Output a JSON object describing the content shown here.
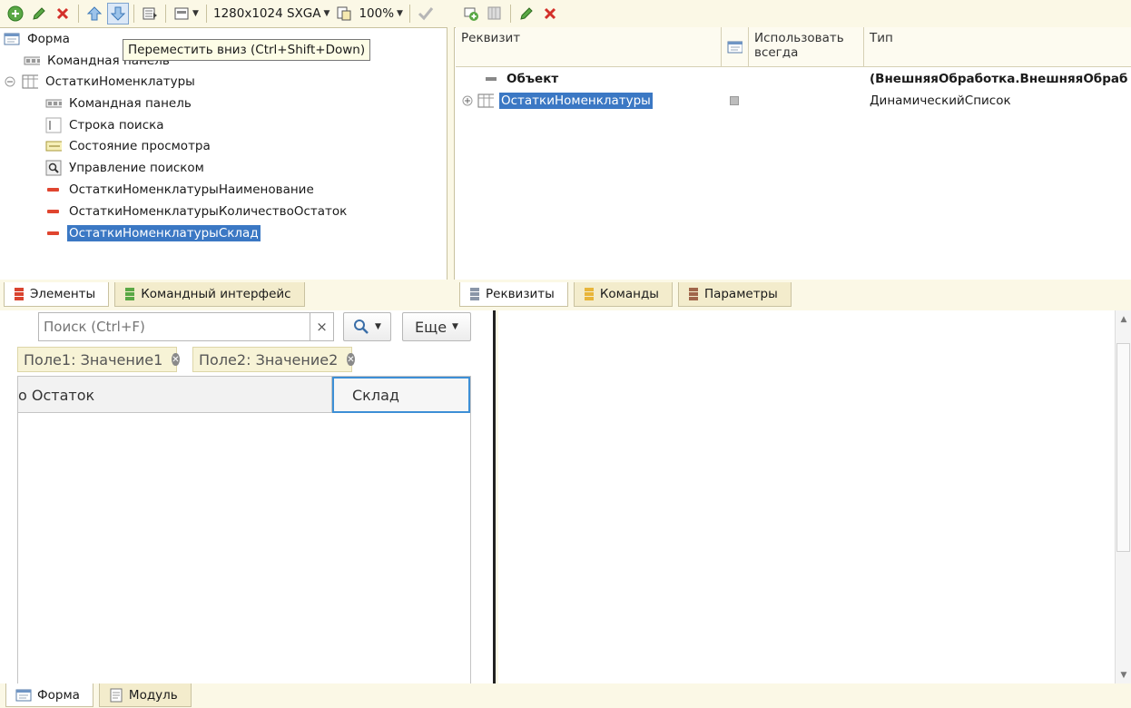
{
  "left_toolbar": {
    "resolution": "1280x1024 SXGA",
    "zoom": "100%"
  },
  "right_toolbar": {},
  "tooltip": "Переместить вниз (Ctrl+Shift+Down)",
  "tree": {
    "items": [
      {
        "label": "Форма",
        "icon": "form-icon"
      },
      {
        "label": "Командная панель",
        "icon": "command-bar-icon"
      },
      {
        "label": "ОстаткиНоменклатуры",
        "icon": "table-icon"
      },
      {
        "label": "Командная панель",
        "icon": "command-bar-icon"
      },
      {
        "label": "Строка поиска",
        "icon": "search-string-icon"
      },
      {
        "label": "Состояние просмотра",
        "icon": "view-state-icon"
      },
      {
        "label": "Управление поиском",
        "icon": "search-control-icon"
      },
      {
        "label": "ОстаткиНоменклатурыНаименование",
        "icon": "field-icon"
      },
      {
        "label": "ОстаткиНоменклатурыКоличествоОстаток",
        "icon": "field-icon"
      },
      {
        "label": "ОстаткиНоменклатурыСклад",
        "icon": "field-icon"
      }
    ]
  },
  "left_tabs": [
    {
      "label": "Элементы"
    },
    {
      "label": "Командный интерфейс"
    }
  ],
  "attributes": {
    "columns": [
      "Реквизит",
      "Использовать всегда",
      "Тип"
    ],
    "rows": [
      {
        "name": "Объект",
        "type": "(ВнешняяОбработка.ВнешняяОбраб..."
      },
      {
        "name": "ОстаткиНоменклатуры",
        "type": "ДинамическийСписок"
      }
    ]
  },
  "right_tabs": [
    {
      "label": "Реквизиты"
    },
    {
      "label": "Команды"
    },
    {
      "label": "Параметры"
    }
  ],
  "preview": {
    "search_placeholder": "Поиск (Ctrl+F)",
    "clear": "×",
    "more_button": "Еще",
    "chips": [
      {
        "field": "Поле1:",
        "value": "Значение1"
      },
      {
        "field": "Поле2:",
        "value": "Значение2"
      }
    ],
    "columns": [
      "о Остаток",
      "Склад"
    ]
  },
  "bottom_tabs": [
    {
      "label": "Форма"
    },
    {
      "label": "Модуль"
    }
  ]
}
